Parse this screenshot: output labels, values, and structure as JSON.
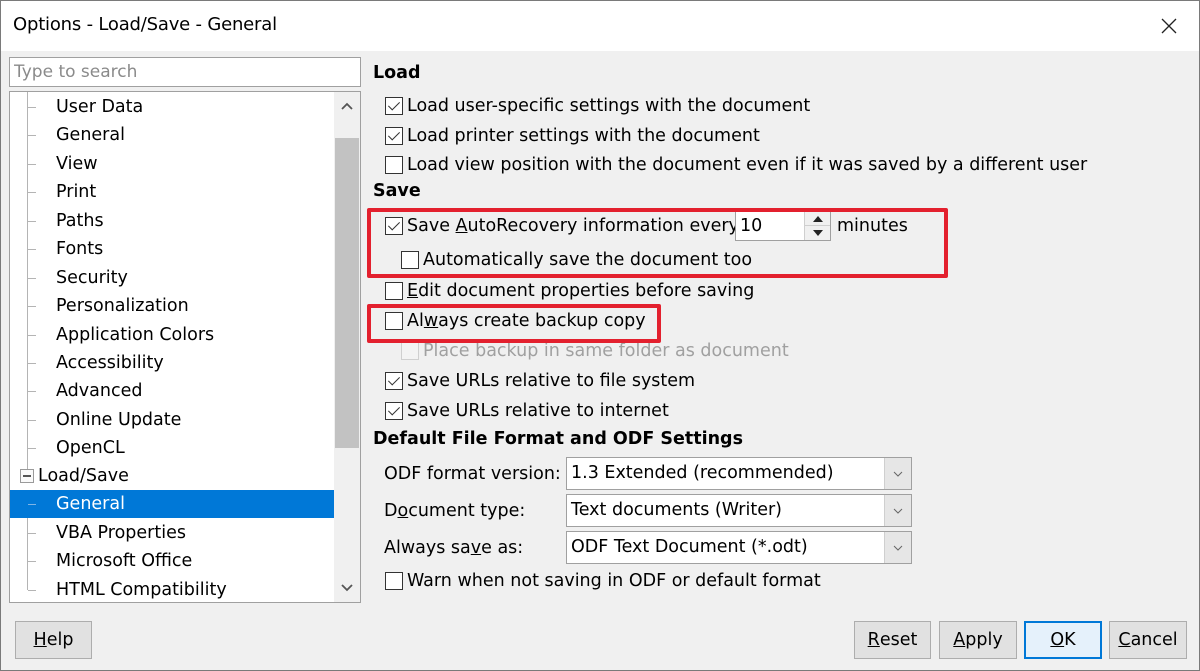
{
  "window": {
    "title": "Options - Load/Save - General",
    "close_icon": "close-icon"
  },
  "sidebar": {
    "search_placeholder": "Type to search",
    "search_value": "",
    "items": [
      {
        "label": "User Data",
        "level": 1,
        "selected": false
      },
      {
        "label": "General",
        "level": 1,
        "selected": false
      },
      {
        "label": "View",
        "level": 1,
        "selected": false
      },
      {
        "label": "Print",
        "level": 1,
        "selected": false
      },
      {
        "label": "Paths",
        "level": 1,
        "selected": false
      },
      {
        "label": "Fonts",
        "level": 1,
        "selected": false
      },
      {
        "label": "Security",
        "level": 1,
        "selected": false
      },
      {
        "label": "Personalization",
        "level": 1,
        "selected": false
      },
      {
        "label": "Application Colors",
        "level": 1,
        "selected": false
      },
      {
        "label": "Accessibility",
        "level": 1,
        "selected": false
      },
      {
        "label": "Advanced",
        "level": 1,
        "selected": false
      },
      {
        "label": "Online Update",
        "level": 1,
        "selected": false
      },
      {
        "label": "OpenCL",
        "level": 1,
        "selected": false
      },
      {
        "label": "Load/Save",
        "level": 0,
        "expanded": true,
        "selected": false
      },
      {
        "label": "General",
        "level": 1,
        "selected": true
      },
      {
        "label": "VBA Properties",
        "level": 1,
        "selected": false
      },
      {
        "label": "Microsoft Office",
        "level": 1,
        "selected": false
      },
      {
        "label": "HTML Compatibility",
        "level": 1,
        "selected": false
      }
    ]
  },
  "load": {
    "title": "Load",
    "options": [
      {
        "label": "Load user-specific settings with the document",
        "checked": true
      },
      {
        "label": "Load printer settings with the document",
        "checked": true
      },
      {
        "label": "Load view position with the document even if it was saved by a different user",
        "checked": false
      }
    ]
  },
  "save": {
    "title": "Save",
    "autorecovery": {
      "label_pre": "Save ",
      "label_mnemonic": "A",
      "label_post": "utoRecovery information every:",
      "checked": true,
      "value": "10",
      "unit": "minutes"
    },
    "autosave": {
      "label": "Automatically save the document too",
      "checked": false
    },
    "edit_props": {
      "label_mnemonic": "E",
      "label_post": "dit document properties before saving",
      "checked": false
    },
    "backup": {
      "label_pre": "Al",
      "label_mnemonic": "w",
      "label_post": "ays create backup copy",
      "checked": false
    },
    "backup_same_folder": {
      "label": "Place backup in same folder as document",
      "checked": false,
      "disabled": true
    },
    "urls_fs": {
      "label": "Save URLs relative to file system",
      "checked": true
    },
    "urls_inet": {
      "label": "Save URLs relative to internet",
      "checked": true
    }
  },
  "format": {
    "title": "Default File Format and ODF Settings",
    "odf_version": {
      "label": "ODF format version:",
      "value": "1.3 Extended (recommended)"
    },
    "doc_type": {
      "label_pre": "D",
      "label_mnemonic": "o",
      "label_post": "cument type:",
      "value": "Text documents (Writer)"
    },
    "save_as": {
      "label_pre": "Always sa",
      "label_mnemonic": "v",
      "label_post": "e as:",
      "value": "ODF Text Document (*.odt)"
    },
    "warn": {
      "label": "Warn when not saving in ODF or default format",
      "checked": false
    }
  },
  "buttons": {
    "help": {
      "mnemonic": "H",
      "rest": "elp"
    },
    "reset": {
      "mnemonic": "R",
      "rest": "eset"
    },
    "apply": {
      "mnemonic": "A",
      "rest": "pply"
    },
    "ok": {
      "mnemonic": "O",
      "rest": "K"
    },
    "cancel": {
      "mnemonic": "C",
      "rest": "ancel"
    }
  },
  "colors": {
    "accent": "#0078d7",
    "highlight_annotation": "#e3202e"
  }
}
